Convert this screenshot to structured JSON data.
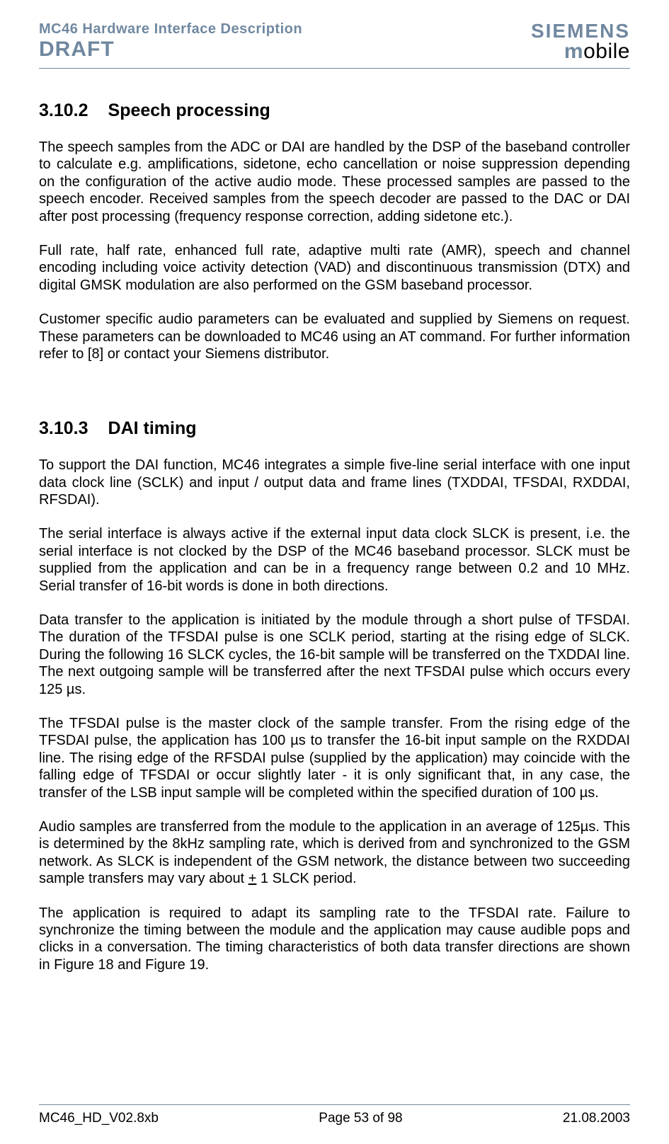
{
  "header": {
    "doc_title": "MC46 Hardware Interface Description",
    "draft": "DRAFT",
    "brand": "SIEMENS",
    "subbrand_m": "m",
    "subbrand_rest": "obile"
  },
  "sections": {
    "s1": {
      "num": "3.10.2",
      "title": "Speech processing",
      "p1": "The speech samples from the ADC or DAI are handled by the DSP of the baseband controller to calculate e.g. amplifications, sidetone, echo cancellation or noise suppression depending on the configuration of the active audio mode. These processed samples are passed to the speech encoder. Received samples from the speech decoder are passed to the DAC or DAI after post processing (frequency response correction, adding sidetone etc.).",
      "p2": "Full rate, half rate, enhanced full rate, adaptive multi rate (AMR), speech and channel encoding including voice activity detection (VAD) and discontinuous transmission (DTX) and digital GMSK modulation are also performed on the GSM baseband processor.",
      "p3": "Customer specific audio parameters can be evaluated and supplied by Siemens on request. These parameters can be downloaded to MC46 using an AT command. For further information refer to [8] or contact your Siemens distributor."
    },
    "s2": {
      "num": "3.10.3",
      "title": "DAI timing",
      "p1": "To support the DAI function, MC46 integrates a simple five-line serial interface with one input data clock line (SCLK) and input / output data and frame lines (TXDDAI, TFSDAI, RXDDAI, RFSDAI).",
      "p2": "The serial interface is always active if the external input data clock SLCK is present, i.e. the serial interface is not clocked by the DSP of the MC46 baseband processor. SLCK must be supplied from the application and can be in a frequency range between 0.2 and 10 MHz. Serial transfer of 16-bit words is done in both directions.",
      "p3": "Data transfer to the application is initiated by the module through a short pulse of TFSDAI. The duration of the TFSDAI pulse is one SCLK period, starting at the rising edge of SLCK. During the following 16 SLCK cycles, the 16-bit sample will be transferred on the TXDDAI line. The next outgoing sample will be transferred after the next TFSDAI pulse which occurs every 125 µs.",
      "p4": "The TFSDAI pulse is the master clock of the sample transfer. From the rising edge of the TFSDAI pulse, the application has 100 µs to transfer the 16-bit input sample on the RXDDAI line. The rising edge of the RFSDAI pulse (supplied by the application) may coincide with the falling edge of TFSDAI or occur slightly later - it is only significant that, in any case, the transfer of the LSB input sample will be completed within the specified duration of 100 µs.",
      "p5_a": "Audio samples are transferred from the module to the application in an average of 125µs. This is determined by the 8kHz sampling rate, which is derived from and synchronized to the GSM network. As SLCK is independent of the GSM network, the distance between two succeeding sample transfers may vary about ",
      "p5_u": "+",
      "p5_b": " 1 SLCK period.",
      "p6": "The application is required to adapt its sampling rate to the TFSDAI rate. Failure to synchronize the timing between the module and the application may cause audible pops and clicks in a conversation. The timing characteristics of both data transfer directions are shown in Figure 18 and Figure 19."
    }
  },
  "footer": {
    "left": "MC46_HD_V02.8xb",
    "center": "Page 53 of 98",
    "right": "21.08.2003"
  }
}
